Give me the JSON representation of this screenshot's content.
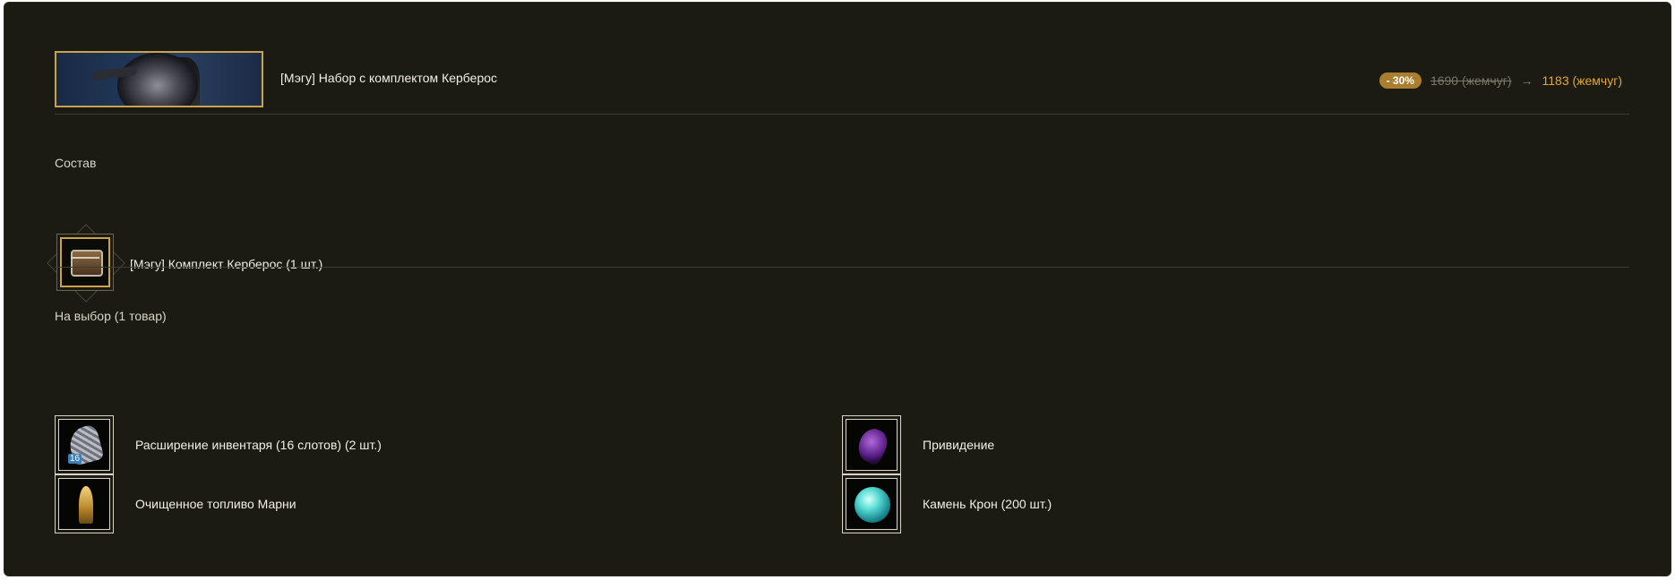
{
  "product": {
    "title": "[Мэгу] Набор с комплектом Керберос",
    "discount_badge": "- 30%",
    "old_price": "1690 (жемчуг)",
    "arrow": "→",
    "new_price": "1183 (жемчуг)",
    "banner_icon": "kerberos-armor-banner"
  },
  "composition": {
    "heading": "Состав",
    "items": [
      {
        "label": "[Мэгу] Комплект Керберос (1 шт.)",
        "icon": "chest-icon"
      }
    ]
  },
  "choice": {
    "heading": "На выбор (1 товар)",
    "items": [
      {
        "label": "Расширение инвентаря (16 слотов) (2 шт.)",
        "icon": "inventory-bag-icon",
        "badge": "16"
      },
      {
        "label": "Привидение",
        "icon": "ghost-icon"
      },
      {
        "label": "Очищенное топливо Марни",
        "icon": "fuel-vial-icon"
      },
      {
        "label": "Камень Крон (200 шт.)",
        "icon": "cron-stone-icon"
      }
    ]
  },
  "colors": {
    "background": "#1b1a13",
    "accent_gold": "#c9a24c",
    "new_price": "#e3a733",
    "badge": "#a97e2e"
  }
}
